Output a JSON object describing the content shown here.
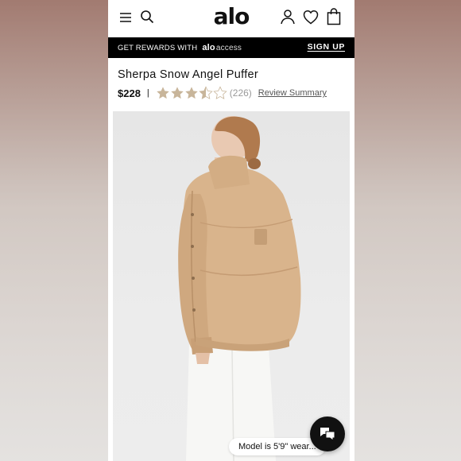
{
  "header": {
    "logo": "alo",
    "icons": [
      "menu-icon",
      "search-icon",
      "account-icon",
      "heart-icon",
      "bag-icon"
    ]
  },
  "rewards_bar": {
    "text": "GET REWARDS WITH",
    "brand": "alo",
    "brand_suffix": "access",
    "signup_label": "SIGN UP"
  },
  "product": {
    "title": "Sherpa Snow Angel Puffer",
    "price": "$228",
    "divider": "|",
    "rating": 3.5,
    "rating_max": 5,
    "review_count": "(226)",
    "review_link": "Review Summary",
    "model_info": "Model is 5'9\" wear..."
  },
  "colors": {
    "star_fill": "#c8b59a",
    "star_empty": "#d9d2c8",
    "jacket": "#d9b48c",
    "rewards_bg": "#000000"
  },
  "chat": {
    "icon": "chat-icon"
  }
}
